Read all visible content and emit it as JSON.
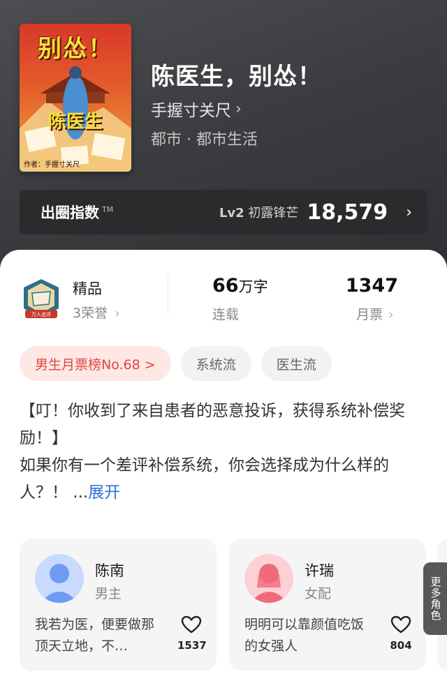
{
  "book": {
    "cover_title": "别怂！",
    "cover_subtitle": "陈医生",
    "cover_author": "作者：手握寸关尺",
    "title": "陈医生，别怂！",
    "author": "手握寸关尺",
    "genre": "都市 · 都市生活"
  },
  "index": {
    "label": "出圈指数",
    "tm": "TM",
    "level": "Lv2",
    "level_name": "初露锋芒",
    "value": "18,579"
  },
  "stats": {
    "honor_title": "精品",
    "honor_sub": "3荣誉",
    "badge_text": "万人追评",
    "words_value": "66",
    "words_unit": "万字",
    "words_label": "连载",
    "tickets_value": "1347",
    "tickets_label": "月票"
  },
  "tags": [
    "男生月票榜No.68 >",
    "系统流",
    "医生流"
  ],
  "description": {
    "text": "【叮！你收到了来自患者的恶意投诉，获得系统补偿奖励！】\n如果你有一个差评补偿系统，你会选择成为什么样的人？！ ...",
    "expand": "展开"
  },
  "roles": [
    {
      "name": "陈南",
      "type": "男主",
      "quote": "我若为医，便要做那顶天立地，不…",
      "likes": "1537",
      "color": "#6f9cf0"
    },
    {
      "name": "许瑞",
      "type": "女配",
      "quote": "明明可以靠颜值吃饭的女强人",
      "likes": "804",
      "color": "#f06a7a"
    }
  ],
  "more_roles": "更多角色",
  "colors": {
    "accent_red": "#e2453d",
    "link_blue": "#2f6fd6"
  }
}
